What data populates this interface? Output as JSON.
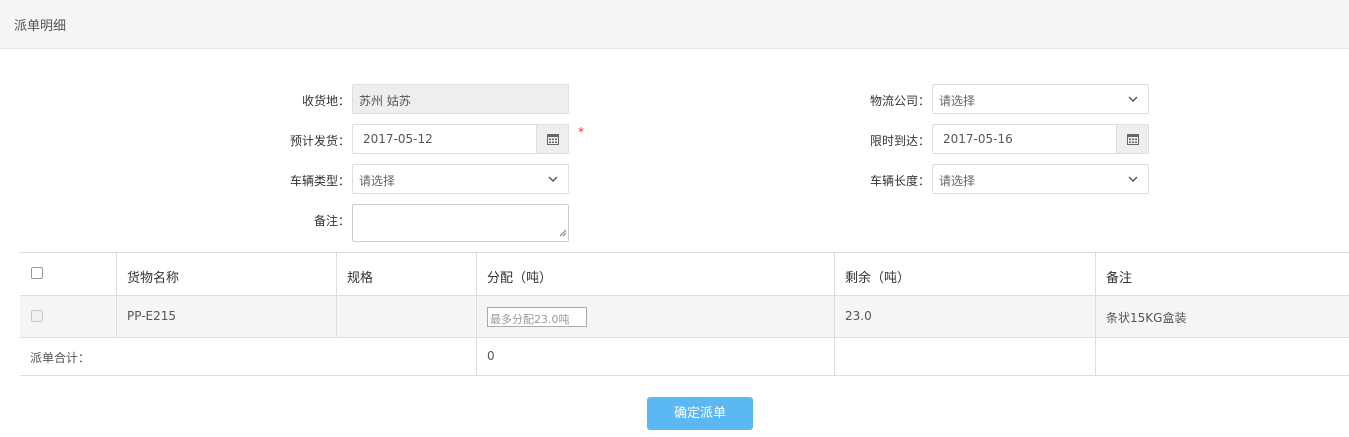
{
  "page": {
    "title": "派单明细"
  },
  "form": {
    "destination": {
      "label": "收货地：",
      "value": "苏州 姑苏"
    },
    "logistics_company": {
      "label": "物流公司：",
      "placeholder": "请选择"
    },
    "planned_ship": {
      "label": "预计发货：",
      "value": "2017-05-12",
      "required_mark": "*"
    },
    "deadline": {
      "label": "限时到达：",
      "value": "2017-05-16"
    },
    "vehicle_type": {
      "label": "车辆类型：",
      "placeholder": "请选择"
    },
    "vehicle_length": {
      "label": "车辆长度：",
      "placeholder": "请选择"
    },
    "remark": {
      "label": "备注：",
      "value": ""
    }
  },
  "table": {
    "headers": [
      "货物名称",
      "规格",
      "分配（吨）",
      "剩余（吨）",
      "备注"
    ],
    "rows": [
      {
        "name": "PP-E215",
        "spec": "",
        "alloc_placeholder": "最多分配23.0吨",
        "remaining": "23.0",
        "note": "条状15KG盒装"
      }
    ],
    "total": {
      "label": "派单合计：",
      "value": "0"
    }
  },
  "actions": {
    "confirm_label": "确定派单"
  },
  "colors": {
    "primary_button": "#5bb8f3",
    "required": "#e4393c"
  }
}
